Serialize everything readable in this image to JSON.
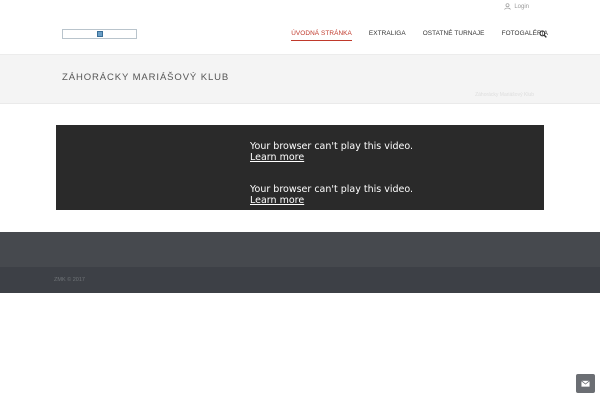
{
  "topbar": {
    "login_label": "Login",
    "login_icon": "user-icon"
  },
  "header": {
    "nav": [
      {
        "label": "Úvodná stránka",
        "active": true
      },
      {
        "label": "Extraliga",
        "active": false
      },
      {
        "label": "Ostatné turnaje",
        "active": false
      },
      {
        "label": "Fotogaléria",
        "active": false
      }
    ],
    "search_icon": "search-icon",
    "accent_color": "#c0392b"
  },
  "titlebar": {
    "title": "Záhorácky Mariášový Klub",
    "breadcrumb": "Záhorácky Mariášový Klub"
  },
  "video": {
    "items": [
      {
        "message": "Your browser can't play this video.",
        "link": "Learn more"
      },
      {
        "message": "Your browser can't play this video.",
        "link": "Learn more"
      }
    ]
  },
  "footer": {
    "copyright": "ZMK © 2017"
  },
  "float_button": {
    "icon": "envelope-icon"
  }
}
